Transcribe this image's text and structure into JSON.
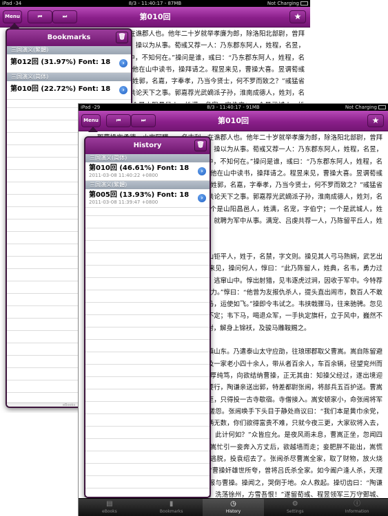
{
  "back_screen": {
    "status": {
      "device": "iPad -34",
      "time": "8/3 - 11:40:17 - 87MB",
      "charging": "Not Charging"
    },
    "nav": {
      "menu_label": "Menu",
      "prev_icon": "⏮",
      "next_icon": "⏭",
      "title": "第010回",
      "star_icon": "★"
    },
    "text": "　　那曹操字孟德，小字阿瞒，一名吉利，在谯郡人也。他年二十岁就举孝廉为郎，除洛阳北部尉，曾拜黄门侍郎，后弃官归乡，今与其叔同投曹操，操以为从事。荀彧又荐一人：乃东郡东阿人，姓程，名昱，字仲德。曹操问之。彧曰：“此人往闻在乡中，不知何在。”操问是谁，彧曰：“乃东郡东阿人，姓程，名昱，字仲德。”曹操乃遣人于乡中寻问。访得他在山中读书，操拜请之。程昱来见，曹操大喜。昱谓荀彧曰：“某孤陋寡闻，不足当公之荐。公之乡人姓郭，名嘉，字奉孝，乃当今贤士，何不罗而致之？”彧猛省曰：“吾几忘却！”遂启操征聘郭嘉到兖州，共论天下之事。郭嘉荐光武嫡派子孙，淮南成德人，姓刘，名晔，字子阳。操即聘晔至。晔又荐二人：一个是山阳昌邑人，姓满，名宠，字伯宁；一个是武城人，姓吕，名虔，字子恪。曹操亦素知这两个名誉，就聘为军中从事。满宠、吕虔共荐一人，乃陈留平丘人，姓毛，名玠，字孝先。曹操亦聘为从事。",
    "popover": {
      "title": "Bookmarks",
      "sections": [
        {
          "header": "三国演义(繁體)",
          "rows": [
            {
              "title": "第012回 (31.97%) Font: 18"
            }
          ]
        },
        {
          "header": "三国演义(简体)",
          "rows": [
            {
              "title": "第010回 (22.72%) Font: 18"
            }
          ]
        }
      ],
      "footer": "eBooks"
    }
  },
  "front_screen": {
    "status": {
      "device": "iPad -29",
      "time": "8/3 - 11:40:17 - 91MB",
      "charging": "Not Charging"
    },
    "nav": {
      "menu_label": "Menu",
      "prev_icon": "⏮",
      "next_icon": "⏭",
      "title": "第010回",
      "star_icon": "★"
    },
    "text": "　　那曹操字孟德，小字阿瞒，一名吉利，在谯郡人也。他年二十岁就举孝廉为郎，除洛阳北部尉，曾拜黄门侍郎，后弃官归乡，今与其叔同投曹操，操以为从事。荀彧又荐一人：乃东郡东阿人，姓程，名昱，字仲德。曹操问之。彧曰：“此人往闻在乡中，不知何在。”操问是谁，彧曰：“乃东郡东阿人，姓程，名昱，字仲德。”曹操乃遣人于乡中寻问。访得他在山中读书，操拜请之。程昱来见，曹操大喜。昱谓荀彧曰：“某孤陋寡闻，不足当公之荐。公之乡人姓郭，名嘉，字奉孝，乃当今贤士，何不罗而致之？”彧猛省曰：“吾几忘却！”遂启操征聘郭嘉到兖州，共论天下之事。郭嘉荐光武嫡派子孙，淮南成德人，姓刘，名晔，字子阳。操即聘晔至。晔又荐二人：一个是山阳昌邑人，姓满，名宠，字伯宁；一个是武城人，姓吕，名虔，字子恪。曹操亦素知这两个名誉，就聘为军中从事。满宠、吕虔共荐一人，乃陈留平丘人，姓毛，名玠，字孝先。曹操亦聘为从事。\n\n　　又有一将引军数百人，来投曹操：乃泰山钜平人，姓于，名禁，字文则。操见其人弓马熟娴，武艺出众，命为点军司马。一日，夏侯惇引一大汉来见，操问何人，惇曰：“此乃陈留人，姓典，名韦，勇力过人。旧跟张邈，与帐下人不和，手杀数十人，逃窜山中。惇出射猎，见韦逐虎过涧，因收于军中。今特荐之于公。”操曰：“吾观此人容貌魁梧，必有勇力。”惇曰：“他曾为友报仇杀人，提头直出闹市，数百人不敢近。只今所使两枝铁戟，重八十斤，挟之上马，运使如飞。”操即令韦试之。韦挟戟骤马，往来驰骋。忽见帐下大旗为风所吹，岌岌欲倒，众军士挟持不定；韦下马，喝退众军，一手执定旗杆，立于风中，巍然不动。操曰：“此古之恶来也！”遂命为帐前都尉，解身上锦袄，及骏马雕鞍赐之。\n\n　　自是曹操部下文有谋臣，武有猛将，威镇山东。乃遣泰山太守应劭，往琅琊郡取父曹嵩。嵩自陈留避难，隐居琅琊；当日接了书信，便与弟曹德及一家老小四十余人，带从者百余人，车百余辆，径望兖州而来。道经徐州，太守陶谦，字恭祖，为人温厚纯笃，向欲结纳曹操，正无其由：知操父经过，遂出境迎接，再拜致敬，大设筵宴，款待两日。曹嵩要行，陶谦亲送出郭，特差都尉张闿，将部兵五百护送。曹嵩率家小行到华、费间，时夏末秋初，大雨骤至，只得投一古寺歇宿。寺僧接入。嵩安顿家小，命张闿将军马屯于两廊。众军衣装，都被雨打湿，同声嗟怨。张闿唤手下头目于静处商议曰：“我们本是黄巾余党，勉强降顺陶谦，未有好处。如今曹家辎重车辆无数，你们欲得富贵不难，只就今夜三更，大家砍将入去，把曹嵩一家杀了，取了财物，同往山中落草。此计何如？”众皆应允。是夜风雨未息，曹嵩正坐，忽闻四壁喊声大举。曹德提剑出看，就被搠死。曹嵩忙引一妾奔入方丈后，欲越墙而走；妾肥胖不能出，嵩慌急，与妾躲于厕中，被乱军所杀。应劭死命逃脱，投袁绍去了。张闿杀尽曹嵩全家，取了财物，放火烧寺，与五百人逃奔淮南去了。后人有诗曰：“曹操奸雄世所夸，曾将吕氏杀全家。如今阖户逢人杀，天理循环报不差。”当下应劭部下有逃命的军士，报与曹操。操闻之，哭倒于地。众人救起。操切齿曰：“陶谦纵兵杀吾父，此仇不共戴天！吾今悉起大军，洗荡徐州，方雪吾恨！”遂留荀彧、程昱领军三万守鄄城、范县、东阿三县，其余尽杀奔徐州来。夏侯惇、于禁、典韦为先锋。操令：但得城池，将城中百姓，尽行屠戮，以雪父仇。当有九江太守边让，与陶谦交厚，闻知徐州有难，自引兵五千来救。操闻之大怒，使夏侯惇于路截杀之。时陈宫为东郡从事，亦与陶谦交厚；闻曹操起兵报仇，欲尽杀百姓，星夜前来见操。操知是为陶谦作说客，欲待不见，又灭不过旧恩，只得请入帐中相见。宫曰：“今闻明公以大兵临徐州，报尊父之仇，所到欲尽杀百姓，某因此特来进言。”",
    "popover": {
      "title": "History",
      "sections": [
        {
          "header": "三国演义(简体)",
          "rows": [
            {
              "title": "第010回 (46.61%) Font: 18",
              "date": "2011-03-08  11:40:22 +0800"
            }
          ]
        },
        {
          "header": "三国演义(繁體)",
          "rows": [
            {
              "title": "第005回 (13.93%) Font: 18",
              "date": "2011-03-08  11:39:47 +0800"
            }
          ]
        }
      ]
    },
    "tabs": [
      {
        "label": "eBooks",
        "icon": "book-icon",
        "glyph": "▤"
      },
      {
        "label": "Bookmarks",
        "icon": "bookmark-icon",
        "glyph": "▮"
      },
      {
        "label": "History",
        "icon": "clock-icon",
        "glyph": "◷",
        "active": true
      },
      {
        "label": "Settings",
        "icon": "gear-icon",
        "glyph": "⚙"
      },
      {
        "label": "Information",
        "icon": "info-icon",
        "glyph": "ⓘ"
      }
    ]
  }
}
